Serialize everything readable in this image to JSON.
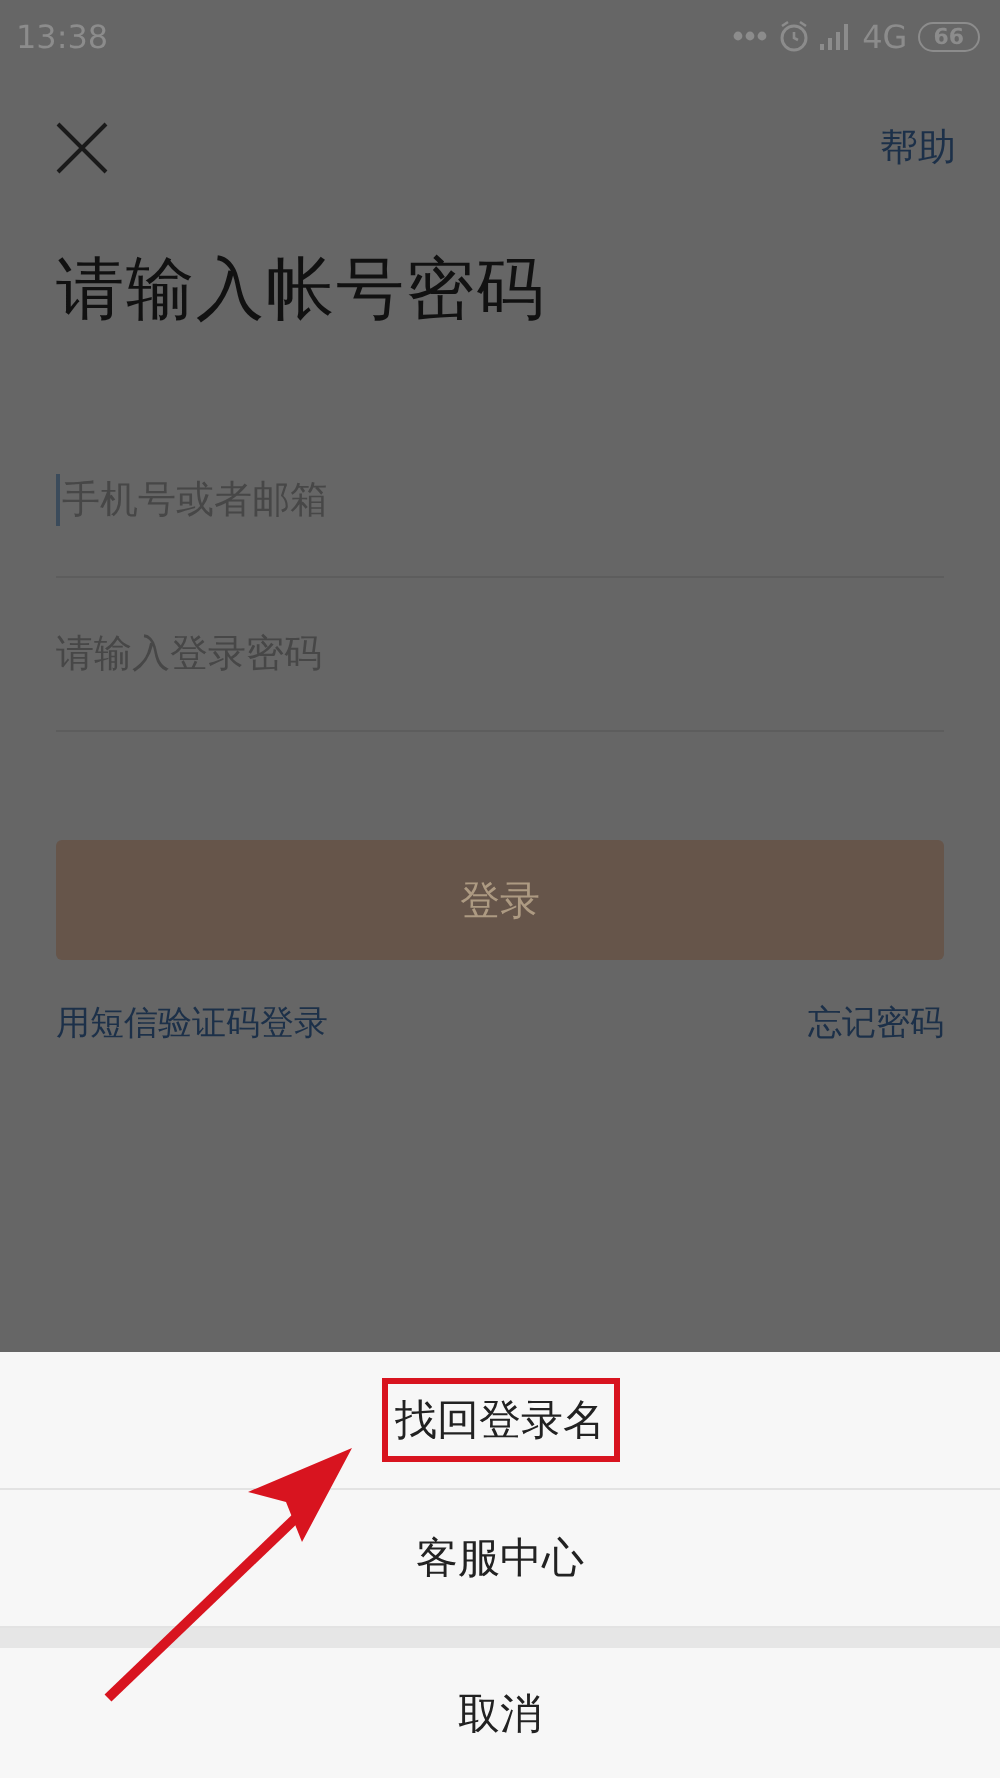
{
  "status_bar": {
    "time": "13:38",
    "network": "4G",
    "battery": "66"
  },
  "header": {
    "help": "帮助"
  },
  "title": "请输入帐号密码",
  "fields": [
    {
      "placeholder": "手机号或者邮箱",
      "focused": true
    },
    {
      "placeholder": "请输入登录密码",
      "focused": false
    }
  ],
  "login_button": {
    "label": "登录",
    "disabled": true
  },
  "links": [
    "用短信验证码登录",
    "忘记密码"
  ],
  "action_sheet": {
    "items": [
      {
        "label": "找回登录名",
        "highlighted": true
      },
      {
        "label": "客服中心",
        "highlighted": false
      }
    ],
    "cancel": "取消"
  }
}
